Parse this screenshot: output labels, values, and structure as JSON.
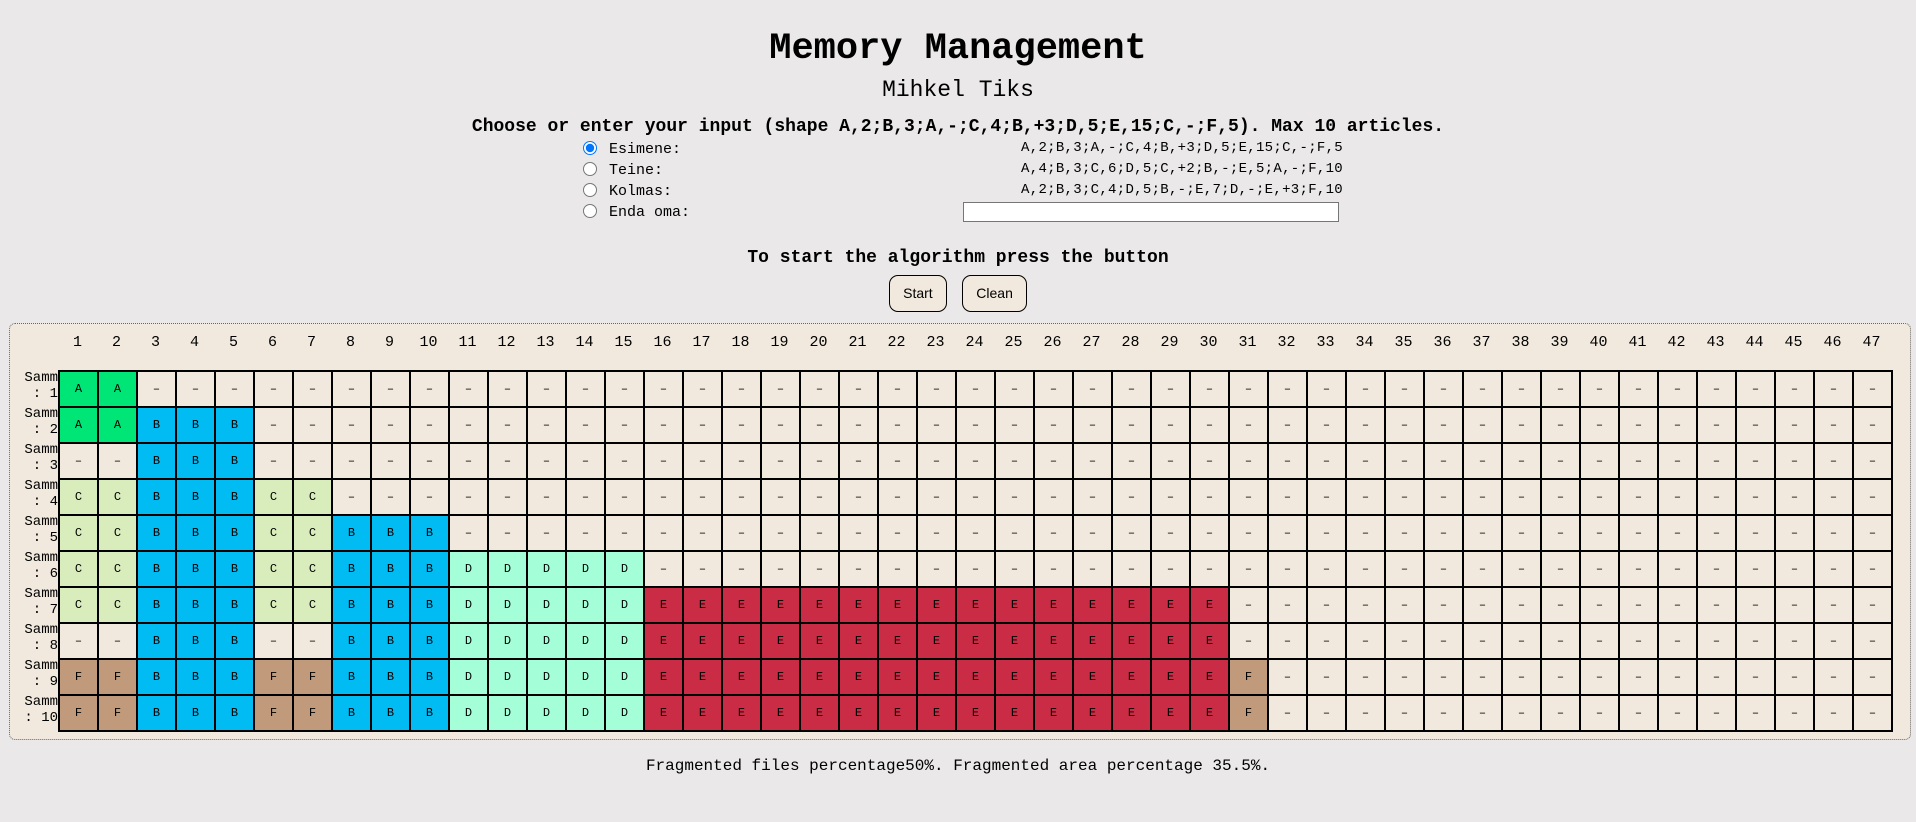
{
  "title": "Memory Management",
  "subtitle": "Mihkel Tiks",
  "instructions": "Choose or enter your input (shape A,2;B,3;A,-;C,4;B,+3;D,5;E,15;C,-;F,5). Max 10 articles.",
  "options": [
    {
      "label": "Esimene:",
      "value": "A,2;B,3;A,-;C,4;B,+3;D,5;E,15;C,-;F,5",
      "checked": true
    },
    {
      "label": "Teine:",
      "value": "A,4;B,3;C,6;D,5;C,+2;B,-;E,5;A,-;F,10",
      "checked": false
    },
    {
      "label": "Kolmas:",
      "value": "A,2;B,3;C,4;D,5;B,-;E,7;D,-;E,+3;F,10",
      "checked": false
    },
    {
      "label": "Enda oma:",
      "value": "",
      "checked": false
    }
  ],
  "start_message": "To start the algorithm press the button",
  "buttons": {
    "start": "Start",
    "clean": "Clean"
  },
  "grid": {
    "column_count": 47,
    "empty_symbol": "–",
    "row_label_prefix": "Samm",
    "rows": [
      "AA",
      "AABBB",
      "--BBB",
      "CCBBBCC",
      "CCBBBCCBBB",
      "CCBBBCCBBBDDDDD",
      "CCBBBCCBBBDDDDDEEEEEEEEEEEEEEE",
      "--BBB--BBBDDDDDEEEEEEEEEEEEEEE",
      "FFBBBFFBBBDDDDDEEEEEEEEEEEEEEEF",
      "FFBBBFFBBBDDDDDEEEEEEEEEEEEEEEF"
    ],
    "colors": {
      "A": "#00e676",
      "B": "#00bcf2",
      "C": "#d8ecbc",
      "D": "#a4ffd8",
      "E": "#c92c44",
      "F": "#c09a7a",
      "-": "#f1e9dd"
    }
  },
  "footer": "Fragmented files percentage50%. Fragmented area percentage 35.5%."
}
